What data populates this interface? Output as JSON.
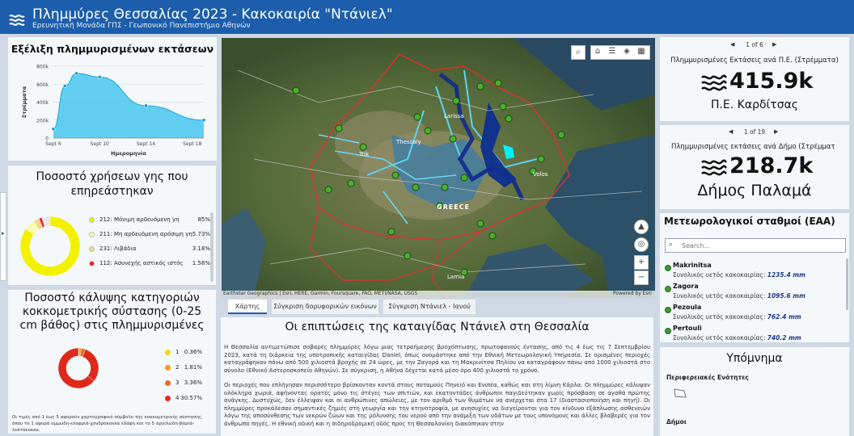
{
  "header": {
    "title": "Πλημμύρες Θεσσαλίας 2023 - Κακοκαιρία \"Ντάνιελ\"",
    "subtitle": "Ερευνητική Μονάδα ΓΠΣ - Γεωπονικό Πανεπιστήμιο Αθηνών"
  },
  "flood_chart": {
    "title": "Εξέλιξη πλημμυρισμένων εκτάσεων",
    "chart_data": {
      "type": "area",
      "title": "Εξέλιξη πλημμυρισμένων εκτάσεων",
      "xlabel": "Ημερομηνία",
      "ylabel": "Στρέμματα",
      "x": [
        "Sept 6",
        "Sept 7",
        "Sept 8",
        "Sept 10",
        "Sept 14",
        "Sept 19"
      ],
      "values": [
        100000,
        580000,
        720000,
        680000,
        360000,
        200000
      ],
      "xticks": [
        "Sept 6",
        "Sept 10",
        "Sept 14",
        "Sept 18"
      ],
      "yticks": [
        "0",
        "200k",
        "400k",
        "600k",
        "800k"
      ],
      "ylim": [
        0,
        800000
      ],
      "color": "#47c7ef"
    }
  },
  "landuse": {
    "title": "Ποσοστό χρήσεων γης που επηρεάστηκαν",
    "chart_data": {
      "type": "pie",
      "labels": [
        "212: Μόνιμη αρδευόμενη γη",
        "211: Μη αρδευόμενη αρόσιμη γη",
        "231: Λιβάδια",
        "112: Ασυνεχής αστικός ιστός"
      ],
      "values": [
        85,
        5.73,
        3.18,
        1.58
      ],
      "display": [
        "85%",
        "5.73%",
        "3.18%",
        "1.58%"
      ],
      "colors": [
        "#f2f200",
        "#fbfbb0",
        "#ecd98a",
        "#ea1f2c"
      ]
    }
  },
  "soil": {
    "title": "Ποσοστό κάλυψης κατηγοριών κοκκομετρικής σύστασης (0-25 cm βάθος) στις πλημμυρισμένες",
    "chart_data": {
      "type": "pie",
      "labels": [
        "1",
        "2",
        "3",
        "4"
      ],
      "values": [
        0.36,
        1.81,
        3.36,
        30.57
      ],
      "display": [
        "0.36%",
        "1.81%",
        "3.36%",
        "30.57%"
      ],
      "colors": [
        "#f6d41c",
        "#f1a11b",
        "#e66f1f",
        "#dd2a1a"
      ]
    },
    "footnote": "Οι τιμές από 1 έως 5 αφορούν χαρτογραφικό σύμβολο της κοκκομετρικής σύστασης, όπου το 1 αφορά αμμώδη-ελαφριά-χονδρόκοκκα εδάφη και το 5 αργιλώδη-βαριά-λεπτόκοκκα."
  },
  "map": {
    "attribution": "Earthstar Geographics | Esri, HERE, Garmin, Foursquare, FAO, METI/NASA, USGS",
    "powered": "Powered by Esri",
    "labels": {
      "larissa": "Larissa",
      "thessaly": "Thessaly",
      "greece": "GREECE",
      "volos": "Volos",
      "lamia": "Lamia",
      "trikala": "Trik"
    },
    "tabs": [
      "Χάρτης",
      "Σύγκριση δορυφορικών εικόνων",
      "Σύγκριση Ντάνιελ - Ιανού"
    ]
  },
  "article": {
    "title": "Οι επιπτώσεις της καταιγίδας Ντάνιελ στη Θεσσαλία",
    "p1": "Η Θεσσαλία αντιμετώπισε σοβαρές πλημμύρες λόγω μιας τετραήμερης βροχόπτωσης, πρωτοφανούς έντασης, από τις 4 έως τις 7 Σεπτεμβρίου 2023, κατά τη διάρκεια της υποτροπικής καταιγίδας Daniel, όπως ονομάστηκε από την Εθνική Μετεωρολογική Υπηρεσία. Σε ορισμένες περιοχές καταγράφηκαν πάνω από 500 χιλιοστά βροχής σε 24 ώρες, με την Ζαγορά και τη Μακρινίτσα Πηλίου να καταγράφουν πάνω από 1000 χιλιοστά στο σύνολο (Εθνικό Αστεροσκοπείο Αθηνών). Σε σύγκριση, η Αθήνα δέχεται κατά μέσο όρο 400 χιλιοστά το χρόνο.",
    "p2": "Οι περιοχές που επλήγησαν περισσότερο βρίσκονταν κοντά στους ποταμούς Πηνειό και Ενιπέα, καθώς και στη λίμνη Κάρλα. Οι πλημμύρες κάλυψαν ολόκληρα χωριά, αφήνοντας ορατές μόνο τις στέγες των σπιτιών, και εκατοντάδες άνθρωποι παγιδεύτηκαν χωρίς πρόσβαση σε αγαθά πρώτης ανάγκης. Δυστυχώς, δεν έλλειψαν και οι ανθρώπινες απώλειες, με τον αριθμό των θυμάτων να ανέρχεται στα 17 (διαστασιοποίηση και πηγή). Οι πλημμύρες προκάλεσαν σημαντικές ζημιές στη γεωργία και την κτηνοτροφία, με ανησυχίες να διεγείρονται για τον κίνδυνο εξάπλωσης ασθενειών λόγω της αποσύνθεσης των νεκρών ζώων και της μόλυνσης του νερού από την ανάμιξη των υδάτων με τους υπονόμους και άλλες βλαβερές για τον άνθρωπο πηγές. Η εθνική οδική και η σιδηροδρομική οδός προς τη Θεσσαλονίκη διακόπηκαν στην"
  },
  "stat1": {
    "pager": "1 of 6",
    "title": "Πλημμυρισμένες Εκτάσεις ανά Π.Ε. (Στρέμματα)",
    "value": "415.9k",
    "label": "Π.Ε. Καρδίτσας"
  },
  "stat2": {
    "pager": "1 of 19",
    "title": "Πλημμυρισμένες εκτάσεις ανά Δήμο (Στρέμματ",
    "value": "218.7k",
    "label": "Δήμος Παλαμά"
  },
  "stations": {
    "title": "Μετεωρολογικοί σταθμοί (ΕΑΑ)",
    "search_placeholder": "Search...",
    "items": [
      {
        "name": "Makrinitsa",
        "label": "Συνολικός υετός κακοκαιρίας:",
        "value": "1235.4 mm"
      },
      {
        "name": "Zagora",
        "label": "Συνολικός υετός κακοκαιρίας:",
        "value": "1095.6 mm"
      },
      {
        "name": "Pezoula",
        "label": "Συνολικός υετός κακοκαιρίας:",
        "value": "762.4 mm"
      },
      {
        "name": "Pertouli",
        "label": "Συνολικός υετός κακοκαιρίας:",
        "value": "740.2 mm"
      }
    ]
  },
  "legend": {
    "title": "Υπόμνημα",
    "section1": "Περιφερειακές Ενότητες",
    "section2": "Δήμοι"
  }
}
